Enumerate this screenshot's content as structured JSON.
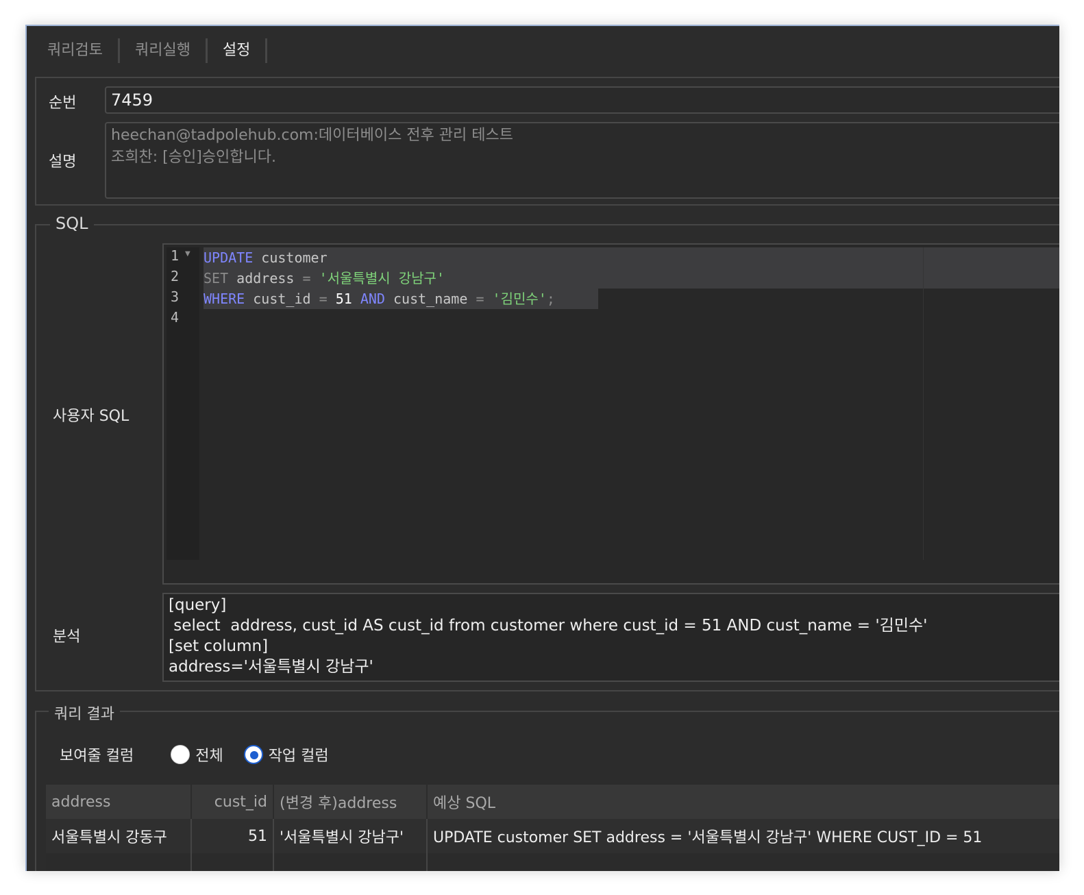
{
  "tabs": [
    {
      "label": "쿼리검토",
      "active": false
    },
    {
      "label": "쿼리실행",
      "active": false
    },
    {
      "label": "설정",
      "active": true
    }
  ],
  "info": {
    "seq_label": "순번",
    "seq_value": "7459",
    "desc_label": "설명",
    "desc_lines": [
      "heechan@tadpolehub.com:데이터베이스 전후 관리 테스트",
      "조희찬: [승인]승인합니다."
    ]
  },
  "sql": {
    "legend": "SQL",
    "user_sql_label": "사용자 SQL",
    "line_numbers": [
      "1",
      "2",
      "3",
      "4"
    ],
    "code": [
      "UPDATE customer",
      "SET address = '서울특별시 강남구'",
      "WHERE cust_id = 51 AND cust_name = '김민수';",
      ""
    ],
    "analysis_label": "분석",
    "analysis_text": "[query]\n select  address, cust_id AS cust_id from customer where cust_id = 51 AND cust_name = '김민수'\n[set column]\naddress='서울특별시 강남구'"
  },
  "result": {
    "legend": "쿼리 결과",
    "show_columns_label": "보여줄 컬럼",
    "radio_all": "전체",
    "radio_work": "작업 컬럼",
    "selected": "작업 컬럼",
    "columns": [
      "address",
      "cust_id",
      "(변경 후)address",
      "예상 SQL"
    ],
    "rows": [
      [
        "서울특별시 강동구",
        "51",
        "'서울특별시 강남구'",
        "UPDATE customer SET address = '서울특별시 강남구' WHERE CUST_ID = 51"
      ]
    ]
  },
  "colors": {
    "keyword": "#7f86ff",
    "string": "#7fd37a",
    "radio_selected": "#1d5fd0",
    "window_bg": "#2c2c2c"
  }
}
